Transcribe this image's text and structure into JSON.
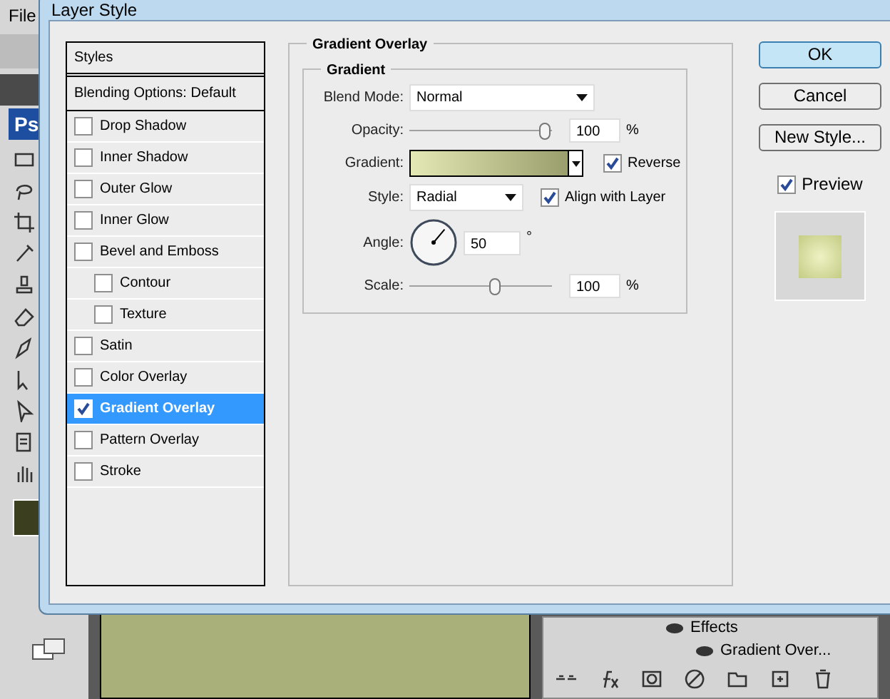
{
  "app": {
    "menu": [
      "File"
    ],
    "logo": "Ps"
  },
  "dialog": {
    "title": "Layer Style",
    "styles_header": "Styles",
    "blending": "Blending Options: Default",
    "effects": [
      {
        "label": "Drop Shadow",
        "checked": false,
        "selected": false
      },
      {
        "label": "Inner Shadow",
        "checked": false,
        "selected": false
      },
      {
        "label": "Outer Glow",
        "checked": false,
        "selected": false
      },
      {
        "label": "Inner Glow",
        "checked": false,
        "selected": false
      },
      {
        "label": "Bevel and Emboss",
        "checked": false,
        "selected": false,
        "children": [
          {
            "label": "Contour",
            "checked": false,
            "selected": false
          },
          {
            "label": "Texture",
            "checked": false,
            "selected": false
          }
        ]
      },
      {
        "label": "Satin",
        "checked": false,
        "selected": false
      },
      {
        "label": "Color Overlay",
        "checked": false,
        "selected": false
      },
      {
        "label": "Gradient Overlay",
        "checked": true,
        "selected": true
      },
      {
        "label": "Pattern Overlay",
        "checked": false,
        "selected": false
      },
      {
        "label": "Stroke",
        "checked": false,
        "selected": false
      }
    ],
    "panel": {
      "title": "Gradient Overlay",
      "group": "Gradient",
      "blend_mode": {
        "label": "Blend Mode:",
        "value": "Normal"
      },
      "opacity": {
        "label": "Opacity:",
        "level": 0.95,
        "value": "100",
        "unit": "%"
      },
      "gradient": {
        "label": "Gradient:"
      },
      "reverse": {
        "label": "Reverse",
        "checked": true
      },
      "style": {
        "label": "Style:",
        "value": "Radial"
      },
      "align": {
        "label": "Align with Layer",
        "checked": true
      },
      "angle": {
        "label": "Angle:",
        "value": "50",
        "unit": "°"
      },
      "scale": {
        "label": "Scale:",
        "level": 0.6,
        "value": "100",
        "unit": "%"
      }
    },
    "buttons": [
      {
        "label": "OK",
        "kind": "default"
      },
      {
        "label": "Cancel",
        "kind": "normal"
      },
      {
        "label": "New Style...",
        "kind": "normal"
      }
    ],
    "preview": {
      "label": "Preview",
      "checked": true
    }
  },
  "layers": {
    "effects_label": "Effects",
    "effect_item": "Gradient Over..."
  }
}
